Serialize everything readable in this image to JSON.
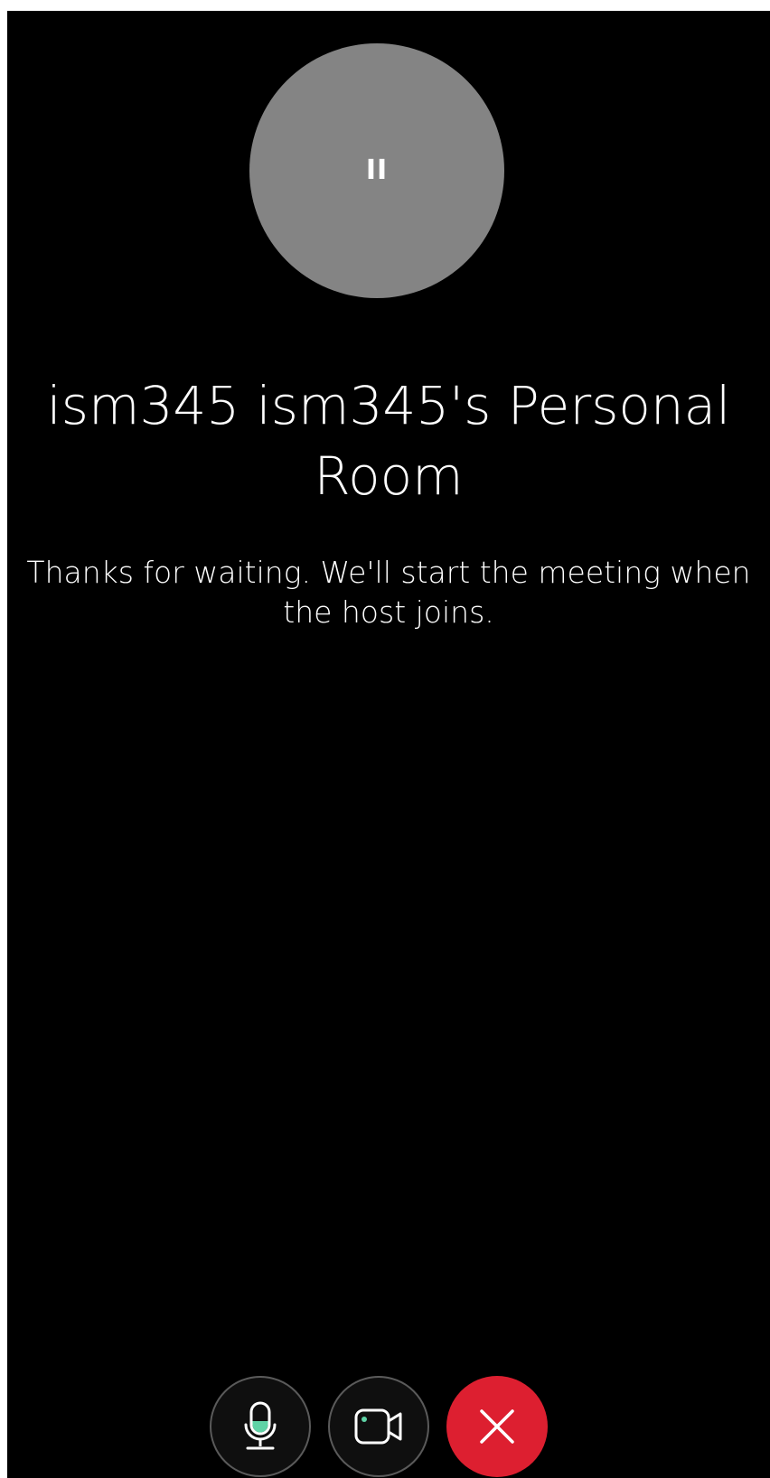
{
  "meeting": {
    "host_initials": "II",
    "title": "ism345 ism345's Personal Room",
    "waiting_message": "Thanks for waiting. We'll start the meeting when the host joins."
  },
  "controls": {
    "buttons": [
      {
        "name": "mute-button",
        "icon": "microphone-icon"
      },
      {
        "name": "video-button",
        "icon": "video-camera-icon"
      },
      {
        "name": "leave-button",
        "icon": "close-icon"
      }
    ]
  },
  "colors": {
    "background": "#000000",
    "avatar": "#848484",
    "mic_level": "#5fd3a6",
    "camera_indicator": "#5fd3a6",
    "leave_button": "#dd1f30",
    "button_border": "#5a5a5a"
  }
}
